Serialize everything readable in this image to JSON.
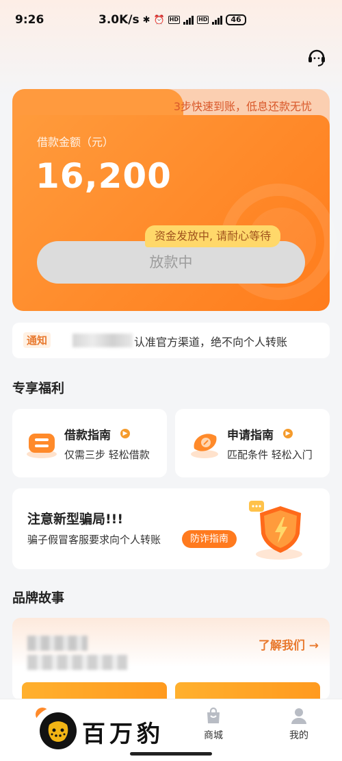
{
  "status_bar": {
    "time": "9:26",
    "net_speed": "3.0K/s",
    "battery": "46"
  },
  "loan_card": {
    "tagline": "3步快速到账，低息还款无忧",
    "amount_label": "借款金额（元）",
    "amount_value": "16,200",
    "status_bubble": "资金发放中, 请耐心等待",
    "disburse_button": "放款中"
  },
  "notice": {
    "tag": "通知",
    "text": "认准官方渠道，绝不向个人转账"
  },
  "benefits": {
    "title": "专享福利",
    "items": [
      {
        "title": "借款指南",
        "subtitle": "仅需三步 轻松借款"
      },
      {
        "title": "申请指南",
        "subtitle": "匹配条件 轻松入门"
      }
    ]
  },
  "fraud_alert": {
    "title": "注意新型骗局!!!",
    "subtitle": "骗子假冒客服要求向个人转账",
    "button": "防诈指南"
  },
  "brand_story": {
    "title": "品牌故事",
    "learn_more": "了解我们 →"
  },
  "bottom_nav": {
    "items": [
      {
        "label": "商城"
      },
      {
        "label": "我的"
      }
    ]
  },
  "watermark": {
    "text": "百万豹"
  },
  "colors": {
    "accent": "#ff8a2a",
    "accent_dark": "#e8792e",
    "bubble": "#ffd86a",
    "background": "#f4f5f7"
  }
}
